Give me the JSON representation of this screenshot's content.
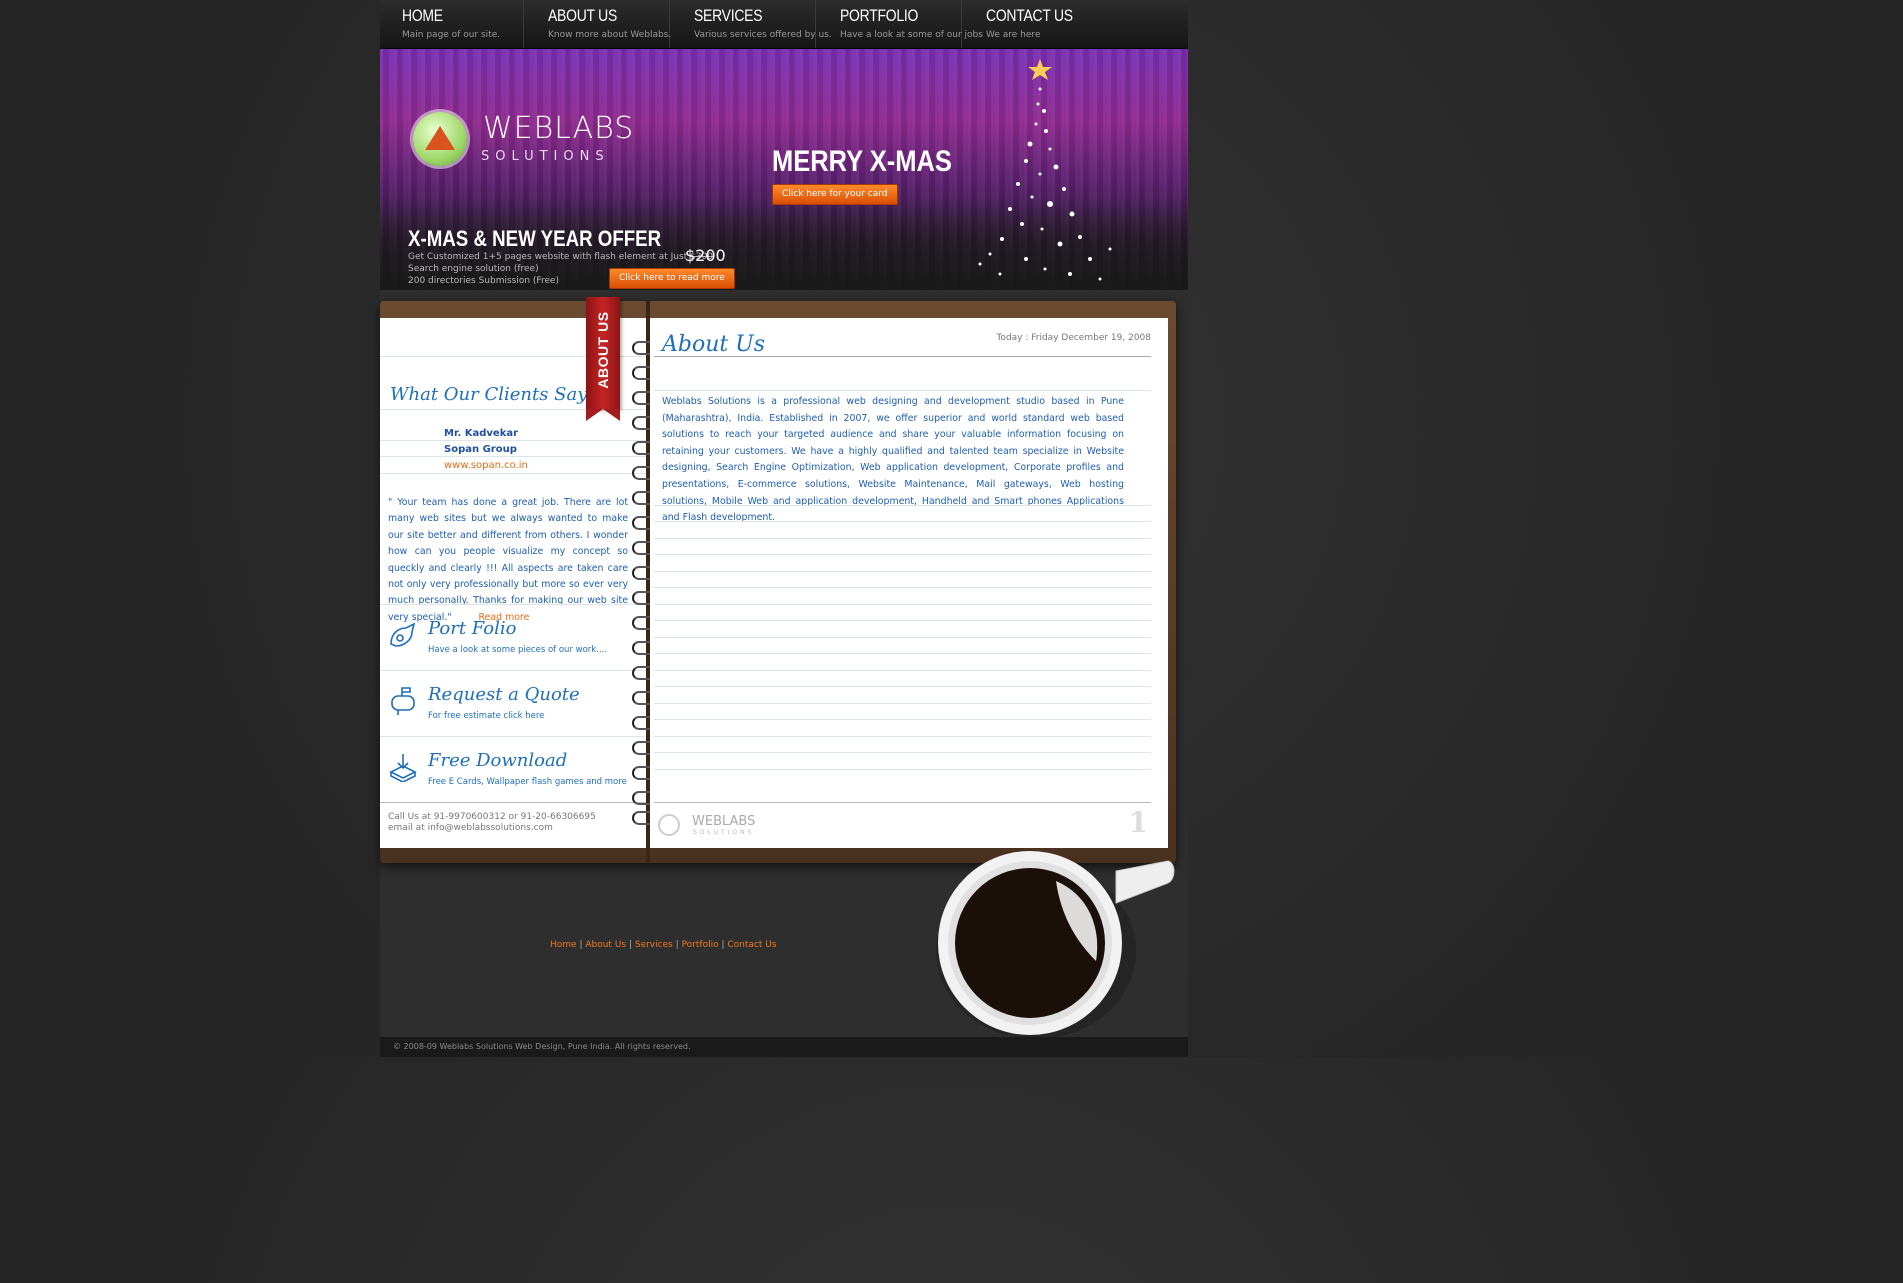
{
  "nav": [
    {
      "title": "HOME",
      "subtitle": "Main page of our site."
    },
    {
      "title": "ABOUT US",
      "subtitle": "Know more about Weblabs."
    },
    {
      "title": "SERVICES",
      "subtitle": "Various services offered by us."
    },
    {
      "title": "PORTFOLIO",
      "subtitle": "Have a look at some of our jobs"
    },
    {
      "title": "CONTACT US",
      "subtitle": "We are here"
    }
  ],
  "banner": {
    "logo_main": "WEBLABS",
    "logo_sub": "SOLUTIONS",
    "xmas_title": "MERRY X-MAS",
    "card_button": "Click here for your card",
    "offer_title": "X-MAS & NEW YEAR OFFER",
    "offer_line1_prefix": "Get Customized 1+5 pages website with flash element at Just ",
    "offer_old_price": "$300",
    "offer_new_price": "$200",
    "offer_line2": "Search engine solution (free)",
    "offer_line3": "200 directories Submission (Free)",
    "read_more_button": "Click here to read more"
  },
  "left_page": {
    "ribbon": "ABOUT US",
    "clients_heading": "What Our Clients Say",
    "client_name": "Mr. Kadvekar",
    "client_company": "Sopan Group",
    "client_site": "www.sopan.co.in",
    "testimonial": "\" Your team has done a great job. There are lot many web sites but we always wanted to make our site better and different from others. I wonder how can you people visualize my concept so queckly and clearly !!! All aspects are taken care not only very professionally but more so ever very much personally. Thanks for making our web site very special.\"",
    "read_more": "Read more",
    "blocks": [
      {
        "title": "Port Folio",
        "subtitle": "Have a look at some pieces of our work...."
      },
      {
        "title": "Request a Quote",
        "subtitle": "For free estimate click here"
      },
      {
        "title": "Free Download",
        "subtitle": "Free E Cards, Wallpaper  flash games and more"
      }
    ],
    "contact_phone": "Call Us at 91-9970600312 or 91-20-66306695",
    "contact_email": "email at info@weblabssolutions.com"
  },
  "right_page": {
    "heading": "About Us",
    "date": "Today : Friday December 19, 2008",
    "body": "Weblabs Solutions is a professional web designing and development studio based in Pune (Maharashtra), India. Established in 2007, we offer superior and world standard web based solutions to reach your targeted audience and share your valuable information focusing on retaining your customers. We have a highly qualified and talented team specialize in Website designing, Search Engine Optimization, Web application development, Corporate profiles and presentations, E-commerce solutions, Website Maintenance, Mail gateways, Web hosting solutions, Mobile Web and application development, Handheld and Smart phones Applications and Flash development.",
    "footer_logo": "WEBLABS",
    "footer_logo_sub": "SOLUTIONS",
    "page_number": "1"
  },
  "footer": {
    "links": [
      "Home",
      "About Us",
      "Services",
      "Portfolio",
      "Contact Us"
    ],
    "separator": " | ",
    "copyright": "© 2008-09 Weblabs Solutions Web Design, Pune India. All rights reserved."
  },
  "colors": {
    "accent_orange": "#f07a1a",
    "link_blue": "#1f5fb0",
    "ribbon_red": "#c62323"
  }
}
